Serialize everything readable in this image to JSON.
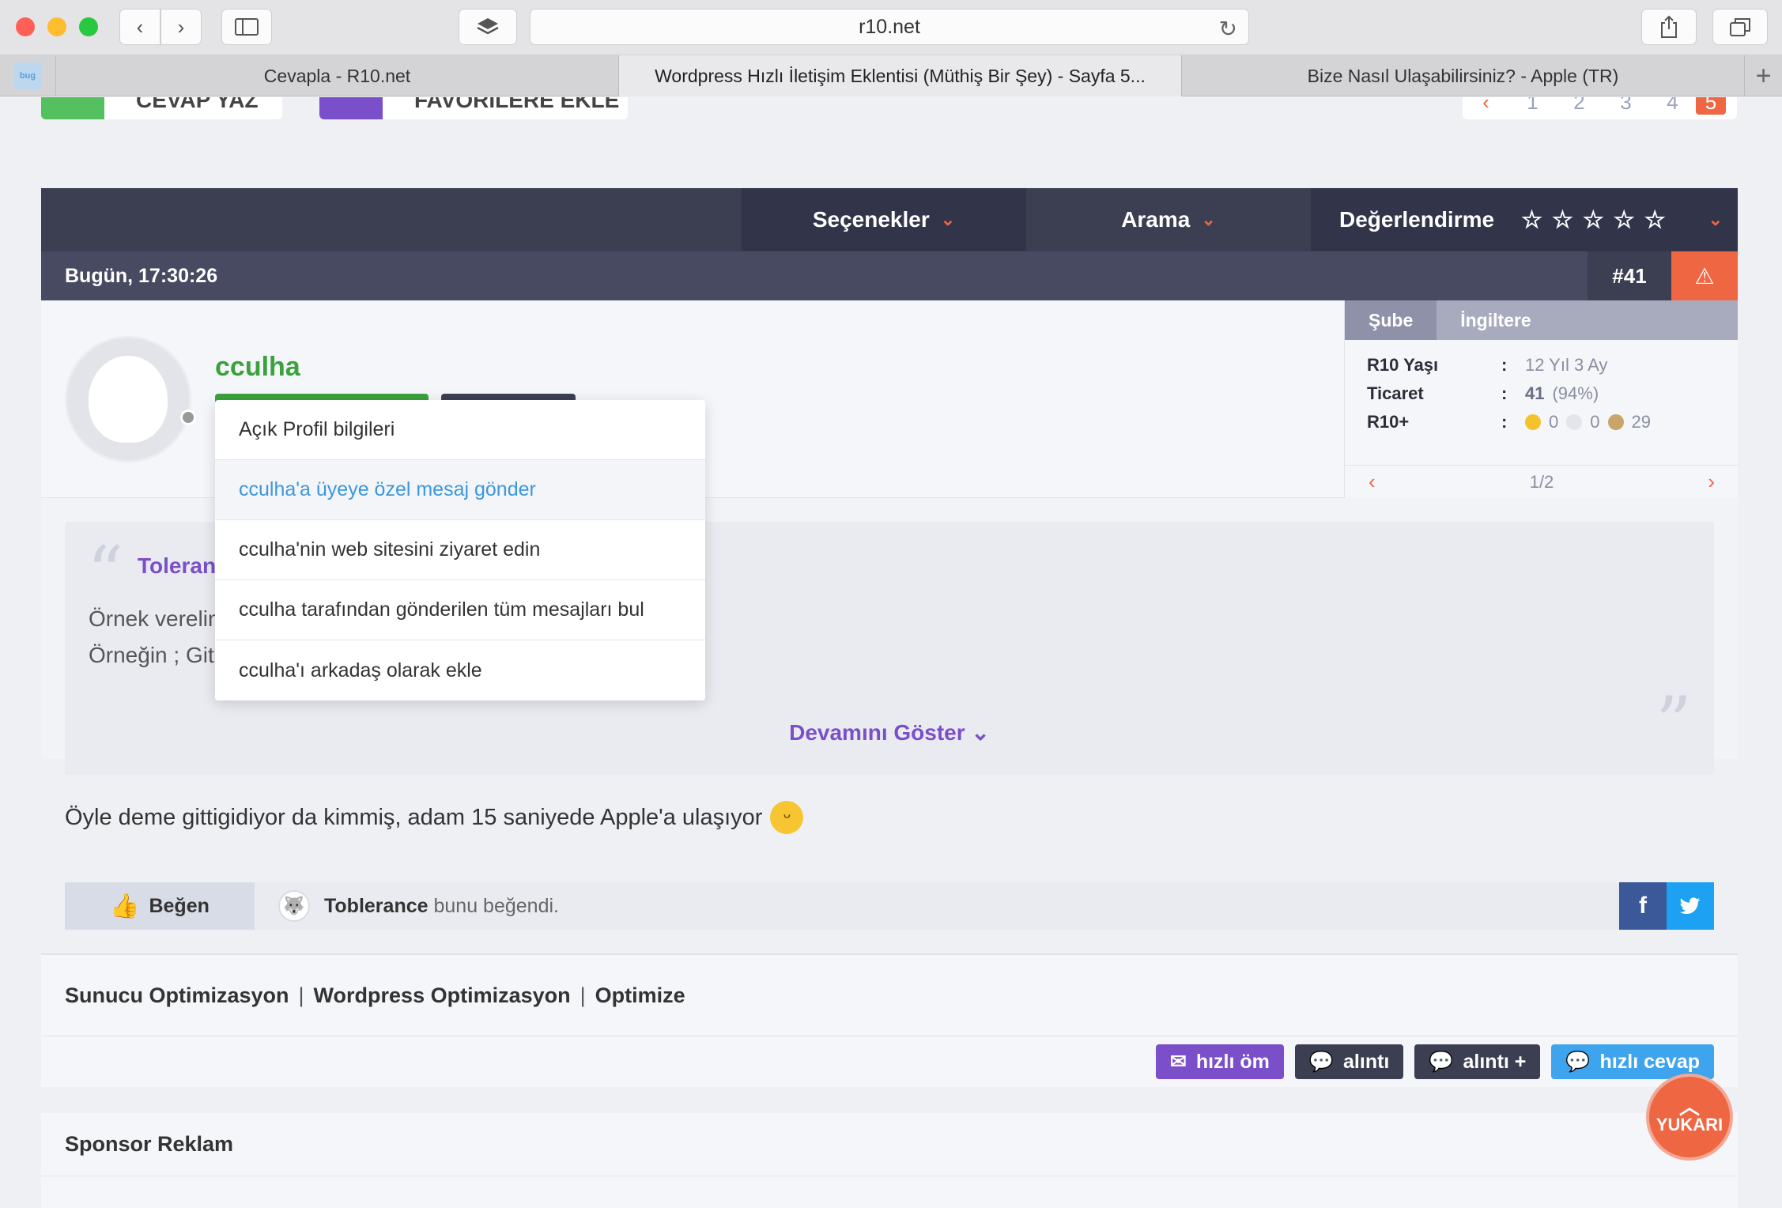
{
  "browser": {
    "url": "r10.net",
    "tabs": [
      {
        "label": "Cevapla - R10.net",
        "active": false
      },
      {
        "label": "Wordpress Hızlı İletişim Eklentisi (Müthiş Bir Şey) - Sayfa 5...",
        "active": true
      },
      {
        "label": "Bize Nasıl Ulaşabilirsiniz? - Apple (TR)",
        "active": false
      }
    ],
    "favicon_text": "bug"
  },
  "top_buttons": {
    "reply": "CEVAP YAZ",
    "favorite": "FAVORİLERE EKLE",
    "pages": [
      "1",
      "2",
      "3",
      "4",
      "5"
    ],
    "current_page": "5"
  },
  "post_menu": {
    "options": "Seçenekler",
    "search": "Arama",
    "rating": "Değerlendirme",
    "stars": [
      "☆",
      "☆",
      "☆",
      "☆",
      "☆"
    ]
  },
  "post": {
    "date": "Bugün, 17:30:26",
    "number": "#41",
    "username": "cculha",
    "side_panel": {
      "tab_active": "Şube",
      "tab_other": "İngiltere",
      "rows": [
        {
          "key": "R10 Yaşı",
          "value": "12 Yıl 3 Ay"
        },
        {
          "key": "Ticaret",
          "value_bold": "41",
          "value": "(94%)"
        },
        {
          "key": "R10+",
          "gold": "0",
          "silver": "0",
          "bronze": "29"
        }
      ],
      "pager": "1/2"
    },
    "quote": {
      "user": "Tolerance",
      "line1": "Örnek verelim",
      "line2": "Örneğin ; Git",
      "more": "Devamını Göster"
    },
    "message": "Öyle deme gittigidiyor da kimmiş, adam 15 saniyede Apple'a ulaşıyor",
    "like": {
      "button": "Beğen",
      "user": "Toblerance",
      "text": "bunu beğendi."
    },
    "signature": [
      "Sunucu Optimizasyon",
      "Wordpress Optimizasyon",
      "Optimize"
    ],
    "actions": {
      "quick_pm": "hızlı öm",
      "quote": "alıntı",
      "quote_plus": "alıntı +",
      "quick_reply": "hızlı cevap"
    }
  },
  "sponsor": "Sponsor Reklam",
  "scroll_top": "YUKARI",
  "dropdown": [
    "Açık Profil bilgileri",
    "cculha'a üyeye özel mesaj gönder",
    "cculha'nin web sitesini ziyaret edin",
    "cculha tarafından gönderilen tüm mesajları bul",
    "cculha'ı arkadaş olarak ekle"
  ],
  "colors": {
    "accent_orange": "#ef6643",
    "brand_purple": "#7a4fc9",
    "username_green": "#3aa23d",
    "header_dark": "#3c3f52"
  }
}
